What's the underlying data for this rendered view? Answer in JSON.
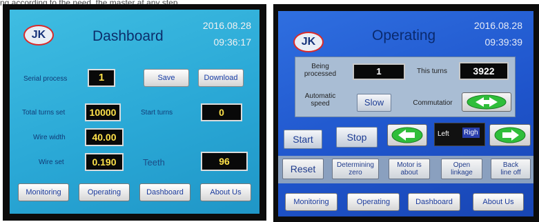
{
  "caption": "ng according to the need, the master at any step",
  "dashboard": {
    "logo": "JK",
    "title": "Dashboard",
    "date": "2016.08.28",
    "time": "09:36:17",
    "serial_process_label": "Serial process",
    "serial_process_value": "1",
    "save_label": "Save",
    "download_label": "Download",
    "total_turns_label": "Total turns set",
    "total_turns_value": "10000",
    "start_turns_label": "Start turns",
    "start_turns_value": "0",
    "wire_width_label": "Wire width",
    "wire_width_value": "40.00",
    "wire_set_label": "Wire set",
    "wire_set_value": "0.190",
    "teeth_label": "Teeth",
    "teeth_value": "96",
    "nav": [
      "Monitoring",
      "Operating",
      "Dashboard",
      "About Us"
    ]
  },
  "operating": {
    "logo": "JK",
    "title": "Operating",
    "date": "2016.08.28",
    "time": "09:39:39",
    "being_processed_label_1": "Being",
    "being_processed_label_2": "processed",
    "being_processed_value": "1",
    "this_turns_label": "This turns",
    "this_turns_value": "3922",
    "auto_speed_label_1": "Automatic",
    "auto_speed_label_2": "speed",
    "slow_label": "Slow",
    "commutator_label": "Commutatior",
    "start_label": "Start",
    "stop_label": "Stop",
    "left_label": "Left",
    "right_label": "Righ",
    "reset_label": "Reset",
    "determining_1": "Determining",
    "determining_2": "zero",
    "motor_1": "Motor is",
    "motor_2": "about",
    "open_1": "Open",
    "open_2": "linkage",
    "back_1": "Back",
    "back_2": "line off",
    "nav": [
      "Monitoring",
      "Operating",
      "Dashboard",
      "About Us"
    ]
  },
  "colors": {
    "dashboard_bg": "#2aa8d6",
    "operating_bg": "#1f55cc",
    "value_text": "#ffe24a",
    "logo_ring": "#d92a2a",
    "arrow_green": "#2fbe3a"
  }
}
